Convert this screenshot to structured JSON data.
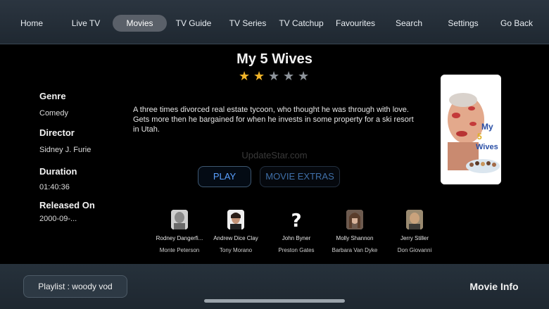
{
  "nav": {
    "items": [
      {
        "label": "Home"
      },
      {
        "label": "Live TV"
      },
      {
        "label": "Movies",
        "active": true
      },
      {
        "label": "TV Guide"
      },
      {
        "label": "TV Series"
      },
      {
        "label": "TV Catchup"
      },
      {
        "label": "Favourites"
      },
      {
        "label": "Search"
      },
      {
        "label": "Settings"
      },
      {
        "label": "Go Back"
      }
    ]
  },
  "movie": {
    "title": "My 5 Wives",
    "rating": 2,
    "rating_max": 5,
    "description": "A three times divorced real estate tycoon, who thought he was through with love. Gets more then he bargained for when he invests in some property for a ski resort in Utah.",
    "watermark": "UpdateStar.com",
    "genre_label": "Genre",
    "genre": "Comedy",
    "director_label": "Director",
    "director": "Sidney J. Furie",
    "duration_label": "Duration",
    "duration": "01:40:36",
    "released_label": "Released On",
    "released": "2000-09-..."
  },
  "buttons": {
    "play": "PLAY",
    "extras": "MOVIE EXTRAS"
  },
  "cast": [
    {
      "name": "Rodney Dangerfi...",
      "role": "Monte Peterson"
    },
    {
      "name": "Andrew Dice Clay",
      "role": "Tony Morano"
    },
    {
      "name": "John Byner",
      "role": "Preston Gates"
    },
    {
      "name": "Molly Shannon",
      "role": "Barbara Van Dyke"
    },
    {
      "name": "Jerry Stiller",
      "role": "Don Giovanni"
    }
  ],
  "footer": {
    "playlist": "Playlist : woody vod",
    "movie_info": "Movie Info"
  },
  "colors": {
    "star_on": "#f0b429",
    "star_off": "#8d939a",
    "play_text": "#5aa0ff"
  }
}
